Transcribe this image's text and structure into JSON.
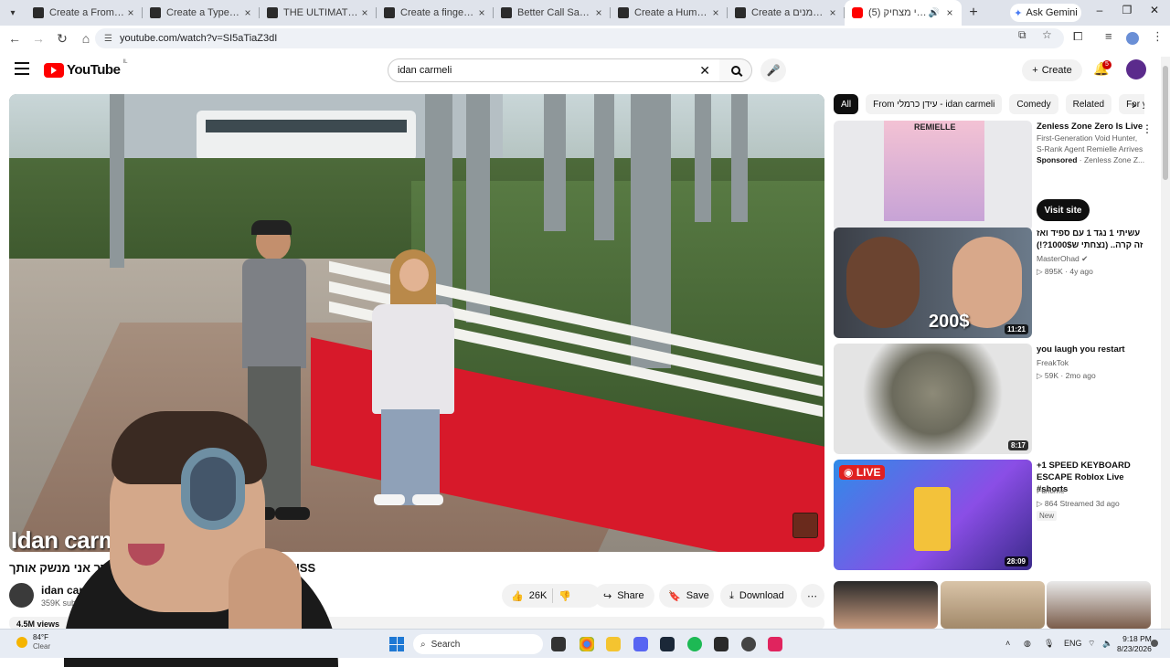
{
  "browser": {
    "tabs": [
      {
        "title": "Create a Fromsoft Sou",
        "active": false
      },
      {
        "title": "Create a Types of Drin",
        "active": false
      },
      {
        "title": "THE ULTIMATE PIZZA",
        "active": false
      },
      {
        "title": "Create a fingers Tier L",
        "active": false
      },
      {
        "title": "Better Call Saul charac",
        "active": false
      },
      {
        "title": "Create a Human Orga",
        "active": false
      },
      {
        "title": "Create a סטריטמנים",
        "active": false
      },
      {
        "title": "(5) אם אני מצחיק",
        "active": true
      }
    ],
    "gemini_label": "Ask Gemini",
    "url": "youtube.com/watch?v=SI5aTiaZ3dI"
  },
  "youtube": {
    "logo_text": "YouTube",
    "country_code": "IL",
    "search_value": "idan carmeli",
    "create_label": "Create",
    "notification_count": "5"
  },
  "video": {
    "overlay_name": "Idan carm",
    "title_visible_left": "ךתוא קשנמ ינא ךר",
    "title_visible_right": "I WE KISS",
    "channel_name": "idan carm",
    "subscribers": "359K subs",
    "views": "4.5M views",
    "like_count": "26K",
    "share_label": "Share",
    "save_label": "Save",
    "download_label": "Download"
  },
  "sidebar": {
    "chips": [
      "All",
      "From עידן כרמלי - idan carmeli",
      "Comedy",
      "Related",
      "For y"
    ],
    "recommendations": [
      {
        "title": "Zenless Zone Zero Is Live",
        "line2": "First-Generation Void Hunter,",
        "line3": "S-Rank Agent Remielle Arrives",
        "sponsor_label": "Sponsored",
        "sponsor_name": "Zenless Zone Z...",
        "cta": "Visit site",
        "thumb_text": "REMIELLE"
      },
      {
        "title": "עשיתי 1 נגד 1 עם ספיד ואז זה קרה.. (נצחתי ש1000$?!)",
        "channel": "MasterOhad",
        "views": "895K",
        "age": "4y ago",
        "duration": "11:21",
        "thumb_text": "200$"
      },
      {
        "title": "you laugh you restart",
        "channel": "FreakTok",
        "views": "59K",
        "age": "2mo ago",
        "duration": "8:17"
      },
      {
        "title": "+1 SPEED KEYBOARD ESCAPE Roblox Live #shorts",
        "channel": "Funtime",
        "views": "864",
        "age": "Streamed 3d ago",
        "badge": "New",
        "duration": "28:09",
        "live_label": "LIVE"
      }
    ]
  },
  "taskbar": {
    "temperature": "84°F",
    "condition": "Clear",
    "search_label": "Search",
    "language": "ENG",
    "time": "9:18 PM",
    "date": "8/23/2026"
  }
}
